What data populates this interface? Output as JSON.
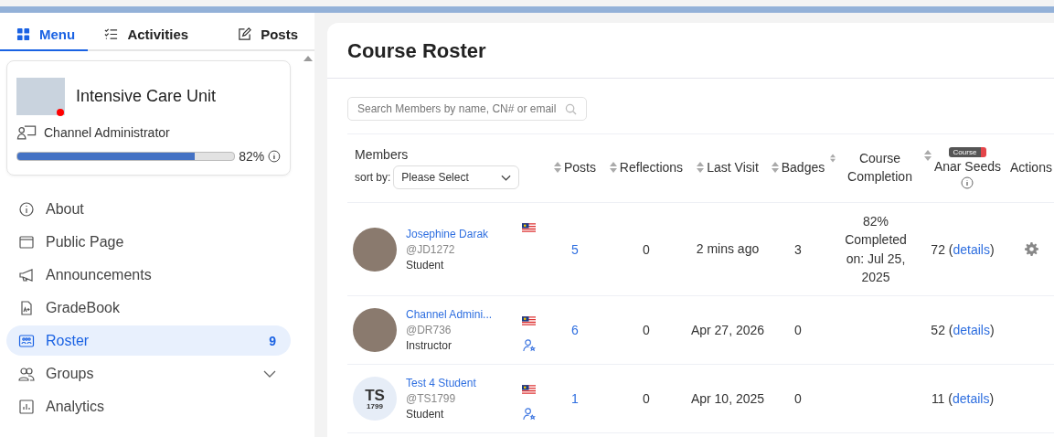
{
  "sidebar": {
    "tabs": [
      {
        "label": "Menu",
        "selected": true
      },
      {
        "label": "Activities",
        "selected": false
      },
      {
        "label": "Posts",
        "selected": false
      }
    ],
    "channel": {
      "name": "Intensive Care Unit",
      "role": "Channel Administrator",
      "progress_text": "82%",
      "level": 0.82,
      "online": true
    },
    "items": [
      {
        "label": "About",
        "selected": false
      },
      {
        "label": "Public Page",
        "selected": false
      },
      {
        "label": "Announcements",
        "selected": false
      },
      {
        "label": "GradeBook",
        "selected": false
      },
      {
        "label": "Roster",
        "selected": true,
        "count": "9"
      },
      {
        "label": "Groups",
        "selected": false,
        "expandable": true
      },
      {
        "label": "Analytics",
        "selected": false
      }
    ]
  },
  "main": {
    "title": "Course Roster",
    "search": {
      "placeholder": "Search Members by name, CN# or email"
    },
    "members_header": {
      "label": "Members",
      "sort_label": "sort by:",
      "sort_value": "Please Select"
    },
    "columns": [
      {
        "label": "Posts",
        "sortable": true
      },
      {
        "label": "Reflections",
        "sortable": true
      },
      {
        "label": "Last Visit",
        "sortable": true
      },
      {
        "label": "Badges",
        "sortable": true
      },
      {
        "label": "Course Completion",
        "sortable": true
      },
      {
        "label": "Anar Seeds",
        "sortable": true,
        "badge": "Course",
        "info": true
      },
      {
        "label": "Actions",
        "sortable": false
      }
    ],
    "rows": [
      {
        "kind": "photo",
        "name": "Josephine Darak",
        "handle": "@JD1272",
        "role": "Student",
        "instructor_icon": false,
        "posts": "5",
        "reflections": "0",
        "last_visit": "2 mins ago",
        "badges": "3",
        "completion": "82% Completed on: Jul 25, 2025",
        "seeds": "72 (",
        "seeds_link": "details",
        "seeds_close": ")",
        "settings": true
      },
      {
        "kind": "photo",
        "name": "Channel Admini...",
        "handle": "@DR736",
        "role": "Instructor",
        "instructor_icon": true,
        "posts": "6",
        "reflections": "0",
        "last_visit": "Apr 27, 2026",
        "badges": "0",
        "seeds": "52 (",
        "seeds_link": "details",
        "seeds_close": ")",
        "settings": false
      },
      {
        "kind": "initials",
        "initials": "TS",
        "initials_sub": "1799",
        "name": "Test 4 Student",
        "handle": "@TS1799",
        "role": "Student",
        "instructor_icon": true,
        "posts": "1",
        "reflections": "0",
        "last_visit": "Apr 10, 2025",
        "badges": "0",
        "seeds": "11 (",
        "seeds_link": "details",
        "seeds_close": ")",
        "settings": false
      }
    ]
  }
}
